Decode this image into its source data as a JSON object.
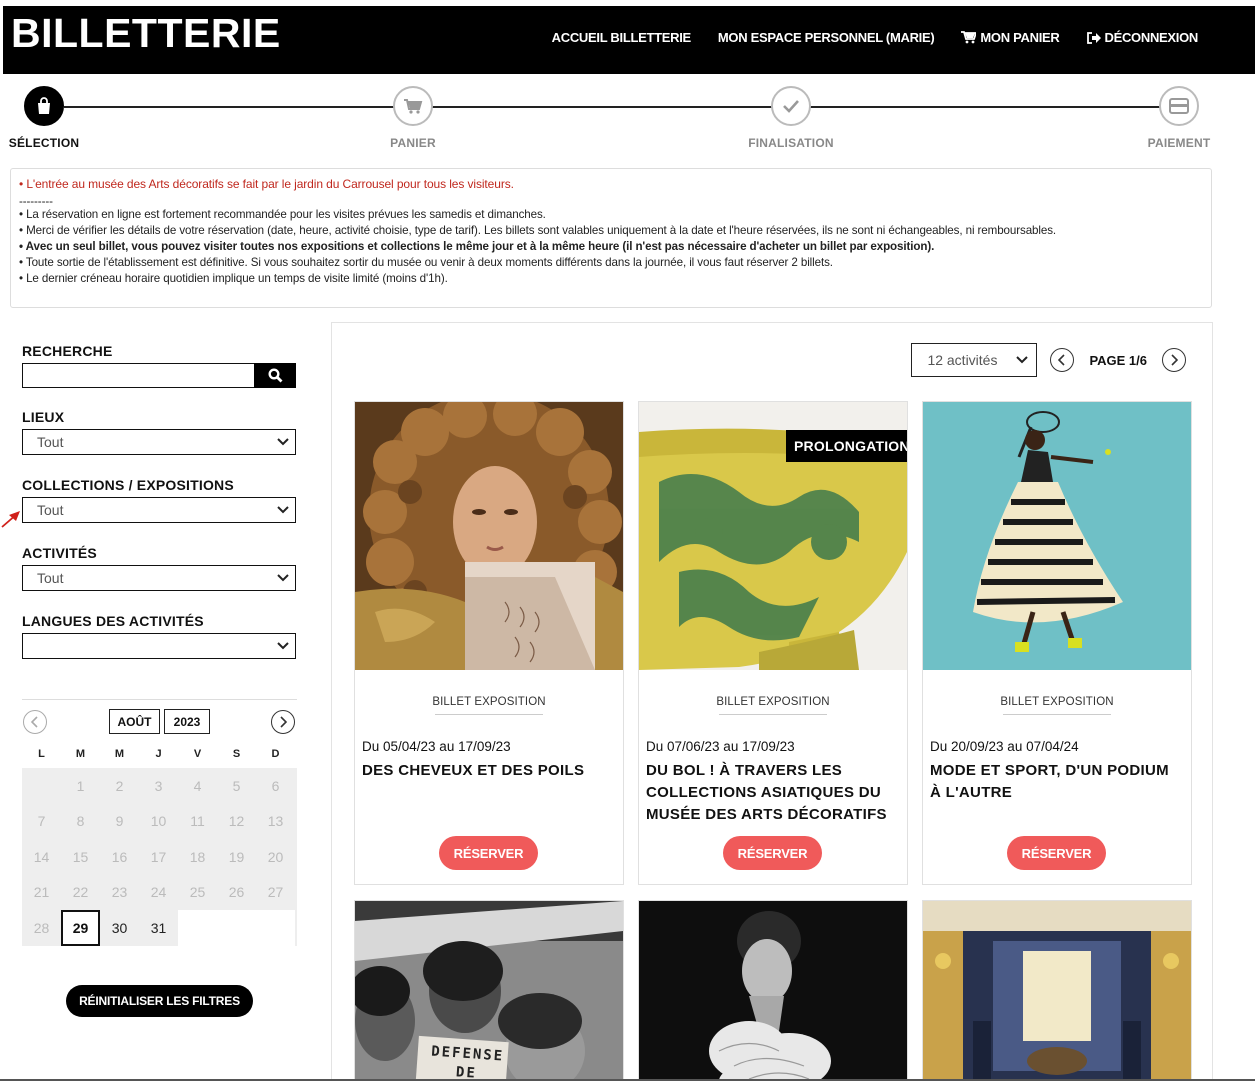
{
  "header": {
    "brand": "BILLETTERIE",
    "nav": [
      {
        "label": "ACCUEIL BILLETTERIE"
      },
      {
        "label": "MON ESPACE PERSONNEL (MARIE)"
      },
      {
        "label": "MON PANIER",
        "icon": "cart-icon"
      },
      {
        "label": "DÉCONNEXION",
        "icon": "logout-icon"
      }
    ]
  },
  "stepper": {
    "steps": [
      {
        "label": "SÉLECTION",
        "icon": "bag-icon",
        "active": true
      },
      {
        "label": "PANIER",
        "icon": "cart-icon"
      },
      {
        "label": "FINALISATION",
        "icon": "check-icon"
      },
      {
        "label": "PAIEMENT",
        "icon": "card-icon"
      }
    ]
  },
  "info": {
    "notice": "• L'entrée au musée des Arts décoratifs se fait par le jardin du Carrousel pour tous les visiteurs.",
    "separator": "---------",
    "lines": [
      "• La réservation en ligne est fortement recommandée pour les visites prévues les samedis et dimanches.",
      "• Merci de vérifier les détails de votre réservation (date, heure, activité choisie, type de tarif). Les billets sont valables uniquement à la date et l'heure réservées, ils ne sont ni échangeables, ni remboursables.",
      "• Avec un seul billet, vous pouvez visiter toutes nos expositions et collections le même jour et à la même heure (il n'est pas nécessaire d'acheter un billet par exposition).",
      "• Toute sortie de l'établissement est définitive. Si vous souhaitez sortir du musée ou venir à deux moments différents dans la journée, il vous faut réserver 2 billets.",
      "• Le dernier créneau horaire quotidien implique un temps de visite limité (moins d'1h)."
    ]
  },
  "filters": {
    "search_label": "RECHERCHE",
    "search_value": "",
    "places_label": "LIEUX",
    "places_value": "Tout",
    "collections_label": "COLLECTIONS / EXPOSITIONS",
    "collections_value": "Tout",
    "activities_label": "ACTIVITÉS",
    "activities_value": "Tout",
    "languages_label": "LANGUES DES ACTIVITÉS",
    "languages_value": "",
    "reset_label": "RÉINITIALISER LES FILTRES"
  },
  "calendar": {
    "month": "AOÛT",
    "year": "2023",
    "weekdays": [
      "L",
      "M",
      "M",
      "J",
      "V",
      "S",
      "D"
    ],
    "selected_day": "29"
  },
  "listing": {
    "per_page": "12 activités",
    "page_label": "PAGE 1/6"
  },
  "cards": [
    {
      "type": "BILLET EXPOSITION",
      "dates": "Du 05/04/23 au 17/09/23",
      "title": "DES CHEVEUX ET DES POILS",
      "button": "RÉSERVER"
    },
    {
      "type": "BILLET EXPOSITION",
      "dates": "Du 07/06/23 au 17/09/23",
      "title": "DU BOL ! À TRAVERS LES COLLECTIONS ASIATIQUES DU MUSÉE DES ARTS DÉCORATIFS",
      "button": "RÉSERVER",
      "badge": "PROLONGATION"
    },
    {
      "type": "BILLET EXPOSITION",
      "dates": "Du 20/09/23 au 07/04/24",
      "title": "MODE ET SPORT, D'UN PODIUM À L'AUTRE",
      "button": "RÉSERVER"
    }
  ],
  "photo_text": {
    "sign": "DEFENSE\nDE"
  },
  "colors": {
    "accent": "#f05a5a",
    "notice": "#c0281e",
    "header_bg": "#000000"
  }
}
